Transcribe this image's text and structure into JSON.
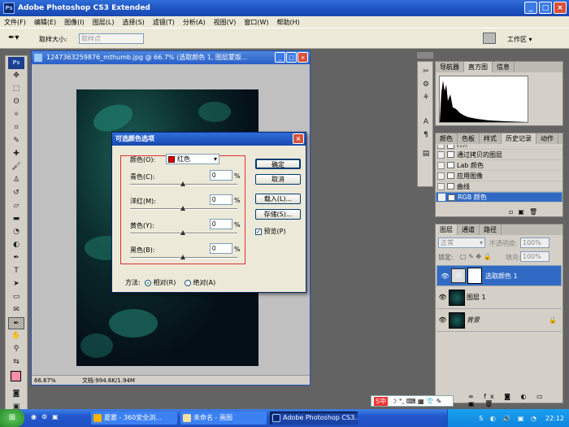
{
  "app": {
    "title": "Adobe Photoshop CS3 Extended",
    "logo": "Ps"
  },
  "menu": [
    "文件(F)",
    "编辑(E)",
    "图像(I)",
    "图层(L)",
    "选择(S)",
    "滤镜(T)",
    "分析(A)",
    "视图(V)",
    "窗口(W)",
    "帮助(H)"
  ],
  "options": {
    "sample_label": "取样大小:",
    "sample_value": "取样点",
    "workspace": "工作区 ▾"
  },
  "document": {
    "title": "1247363259876_mthumb.jpg @ 66.7% (选取颜色 1, 图层蒙版...",
    "zoom": "66.67%",
    "doc_info": "文档:994.6K/1.94M"
  },
  "dialog": {
    "title": "可选颜色选项",
    "color_label": "颜色(O):",
    "color_value": "红色",
    "sliders": [
      {
        "label": "青色(C):",
        "value": "0",
        "unit": "%"
      },
      {
        "label": "洋红(M):",
        "value": "0",
        "unit": "%"
      },
      {
        "label": "黄色(Y):",
        "value": "0",
        "unit": "%"
      },
      {
        "label": "黑色(B):",
        "value": "0",
        "unit": "%"
      }
    ],
    "buttons": {
      "ok": "确定",
      "cancel": "取消",
      "load": "载入(L)...",
      "save": "存储(S)..."
    },
    "preview": "预览(P)",
    "method_label": "方法:",
    "relative": "相对(R)",
    "absolute": "绝对(A)",
    "method_selected": "relative"
  },
  "nav_panel": {
    "tabs": [
      "导航器",
      "直方图",
      "信息"
    ],
    "active": 1
  },
  "history_panel": {
    "tabs": [
      "颜色",
      "色板",
      "样式",
      "历史记录",
      "动作"
    ],
    "active": 3,
    "items": [
      "打开",
      "通过拷贝的图层",
      "Lab 颜色",
      "应用图像",
      "曲线",
      "RGB 颜色"
    ],
    "selected": 5
  },
  "layers_panel": {
    "tabs": [
      "图层",
      "通道",
      "路径"
    ],
    "blend_mode": "正常",
    "opacity_label": "不透明度:",
    "opacity_value": "100%",
    "lock_label": "锁定:",
    "fill_label": "填充:",
    "fill_value": "100%",
    "layers": [
      {
        "name": "选取颜色 1",
        "kind": "adjustment"
      },
      {
        "name": "图层 1",
        "kind": "pixel"
      },
      {
        "name": "背景",
        "kind": "background"
      }
    ]
  },
  "taskbar": {
    "tasks": [
      "夏雾 - 360安全浏...",
      "未命名 - 画图",
      "Adobe Photoshop CS3..."
    ],
    "clock": "22:12",
    "ime": "S中"
  },
  "colors": {
    "foreground": "#ff8fa8",
    "accent": "#316ac5"
  }
}
